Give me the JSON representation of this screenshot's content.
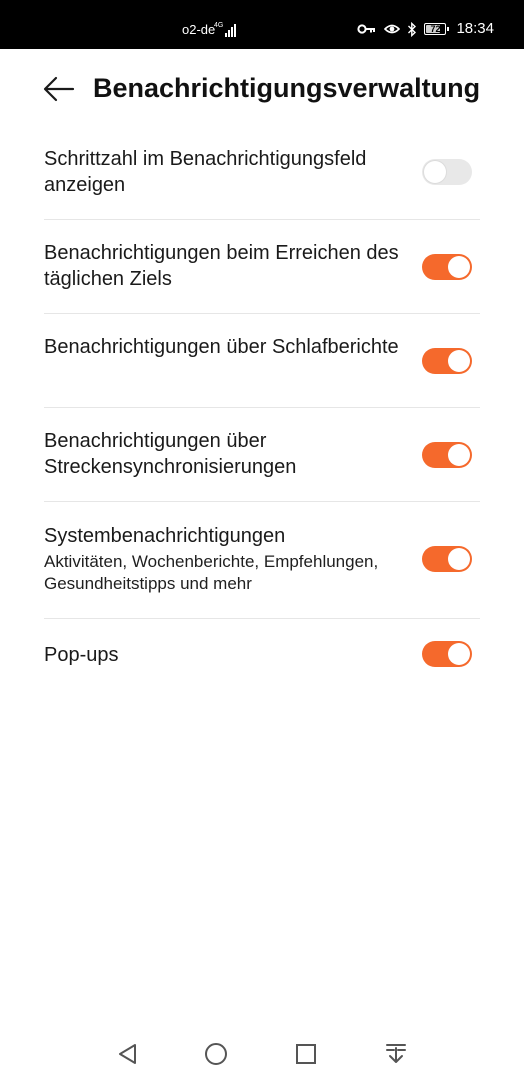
{
  "status_bar": {
    "carrier": "o2-de",
    "network": "4G",
    "battery_level": "72",
    "time": "18:34",
    "icons": [
      "signal-icon",
      "key-icon",
      "eye-icon",
      "bluetooth-icon",
      "battery-icon"
    ]
  },
  "header": {
    "back_icon": "arrow-left-icon",
    "title": "Benachrichtigungsverwaltung"
  },
  "settings": [
    {
      "title": "Schrittzahl im Benachrichtigungsfeld anzeigen",
      "subtitle": "",
      "enabled": false
    },
    {
      "title": "Benachrichtigungen beim Erreichen des täglichen Ziels",
      "subtitle": "",
      "enabled": true
    },
    {
      "title": "Benachrichtigungen über Schlafberichte",
      "subtitle": "",
      "enabled": true
    },
    {
      "title": "Benachrichtigungen über Streckensynchronisierungen",
      "subtitle": "",
      "enabled": true
    },
    {
      "title": "Systembenachrichtigungen",
      "subtitle": "Aktivitäten, Wochenberichte, Empfehlungen, Gesundheitstipps und mehr",
      "enabled": true
    },
    {
      "title": "Pop-ups",
      "subtitle": "",
      "enabled": true
    }
  ],
  "colors": {
    "accent": "#f5692c",
    "toggle_off": "#e8e8e8",
    "divider": "#e6e6e6",
    "status_bar": "#000000"
  },
  "nav_bar": {
    "icons": [
      "back-triangle-icon",
      "home-circle-icon",
      "recents-square-icon",
      "notification-pulldown-icon"
    ]
  }
}
